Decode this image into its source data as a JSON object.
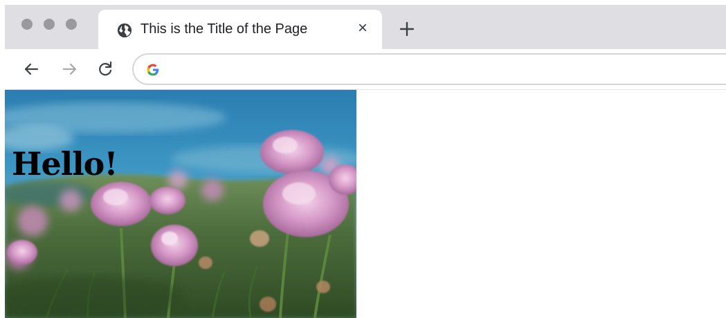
{
  "browser": {
    "tab": {
      "title": "This is the Title of the Page",
      "favicon": "globe-icon",
      "close_label": "×"
    },
    "new_tab_icon": "plus-icon",
    "toolbar": {
      "back_icon": "arrow-left-icon",
      "forward_icon": "arrow-right-icon",
      "reload_icon": "reload-icon",
      "search_engine_icon": "google-g-icon",
      "address_value": ""
    }
  },
  "page": {
    "heading": "Hello!",
    "hero_image": "pink-flowers-photo"
  },
  "colors": {
    "tabstrip": "#dfdfe3",
    "traffic_light": "#9a9a9e",
    "omnibox_border": "#d6d6da"
  }
}
